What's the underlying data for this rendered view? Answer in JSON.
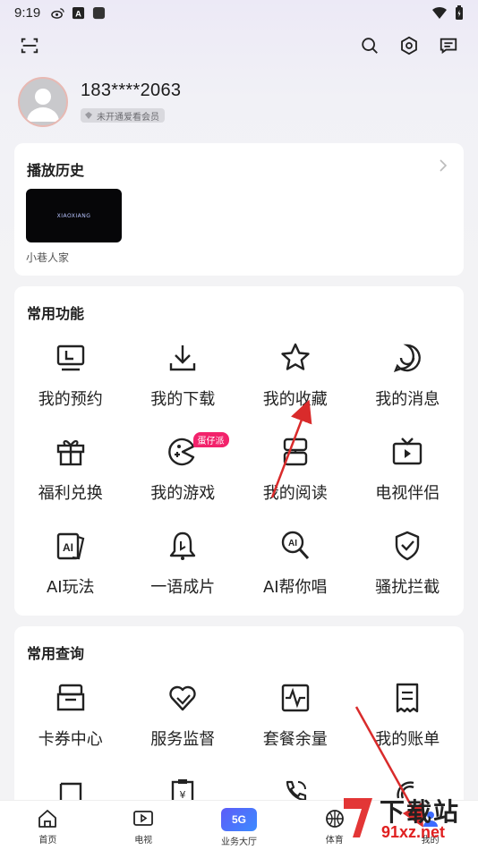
{
  "status": {
    "time": "9:19"
  },
  "profile": {
    "phone": "183****2063",
    "member_label": "未开通爱看会员"
  },
  "history": {
    "title": "播放历史",
    "items": [
      {
        "label": "小巷人家"
      }
    ]
  },
  "functions": {
    "title": "常用功能",
    "items": [
      {
        "label": "我的预约",
        "icon": "monitor-icon"
      },
      {
        "label": "我的下载",
        "icon": "download-icon"
      },
      {
        "label": "我的收藏",
        "icon": "star-icon"
      },
      {
        "label": "我的消息",
        "icon": "smile-icon"
      },
      {
        "label": "福利兑换",
        "icon": "gift-icon"
      },
      {
        "label": "我的游戏",
        "icon": "game-icon",
        "tag": "蛋仔派"
      },
      {
        "label": "我的阅读",
        "icon": "book-icon"
      },
      {
        "label": "电视伴侣",
        "icon": "tv-icon"
      },
      {
        "label": "AI玩法",
        "icon": "ai-cards-icon"
      },
      {
        "label": "一语成片",
        "icon": "bell-icon"
      },
      {
        "label": "AI帮你唱",
        "icon": "ai-mic-icon"
      },
      {
        "label": "骚扰拦截",
        "icon": "shield-icon"
      }
    ]
  },
  "queries": {
    "title": "常用查询",
    "items": [
      {
        "label": "卡券中心",
        "icon": "coupon-icon"
      },
      {
        "label": "服务监督",
        "icon": "heart-icon"
      },
      {
        "label": "套餐余量",
        "icon": "pulse-icon"
      },
      {
        "label": "我的账单",
        "icon": "bill-icon"
      }
    ]
  },
  "bottom_nav": {
    "items": [
      {
        "label": "首页",
        "icon": "home-icon"
      },
      {
        "label": "电视",
        "icon": "tv-play-icon"
      },
      {
        "label": "业务大厅",
        "icon": "5g-icon",
        "badge": "5G"
      },
      {
        "label": "体育",
        "icon": "basketball-icon"
      },
      {
        "label": "我的",
        "icon": "profile-icon"
      }
    ]
  },
  "thumb_logo": "XIAOXIANG",
  "watermark": {
    "line1": "下载站",
    "line2": "91xz.net"
  },
  "colors": {
    "accent": "#5d5cf8",
    "tag": "#f2226b",
    "arrow": "#d92b2b"
  }
}
